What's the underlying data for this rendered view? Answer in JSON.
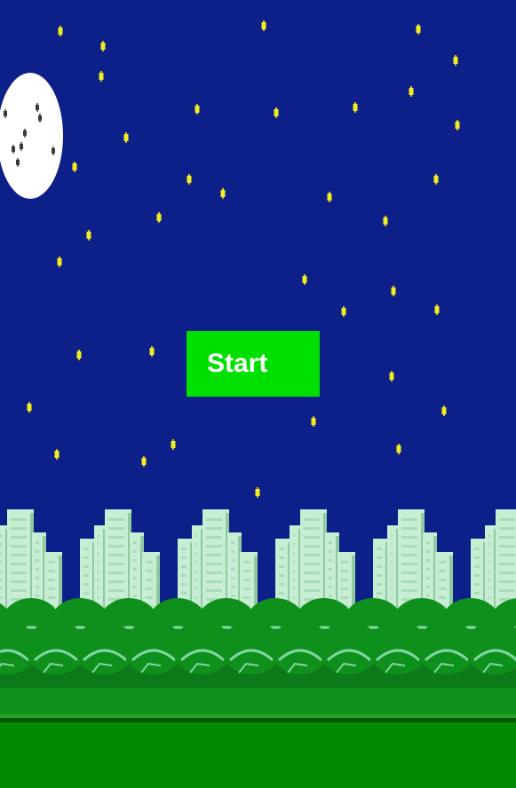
{
  "start_button": {
    "label": "Start"
  },
  "scene": {
    "time_of_day": "night",
    "icons": [
      "moon-icon",
      "star-icon",
      "building-icon",
      "bush-icon"
    ]
  },
  "colors": {
    "sky": "#0d1f88",
    "star": "#f2ee1e",
    "moon": "#ffffff",
    "moon_crater": "#3a3a3a",
    "building": "#c7edd2",
    "building_shade": "#8fcaa0",
    "building_window": "#a9dcb7",
    "bush": "#0f8f1c",
    "bush_outline": "#7fd7a0",
    "bush_dark": "#0c7a18",
    "ground": "#008a00",
    "ground_line_dark": "#045a04",
    "ground_line_light": "#2aa02a",
    "start_button": "#00e000",
    "start_text": "#ffffff"
  }
}
